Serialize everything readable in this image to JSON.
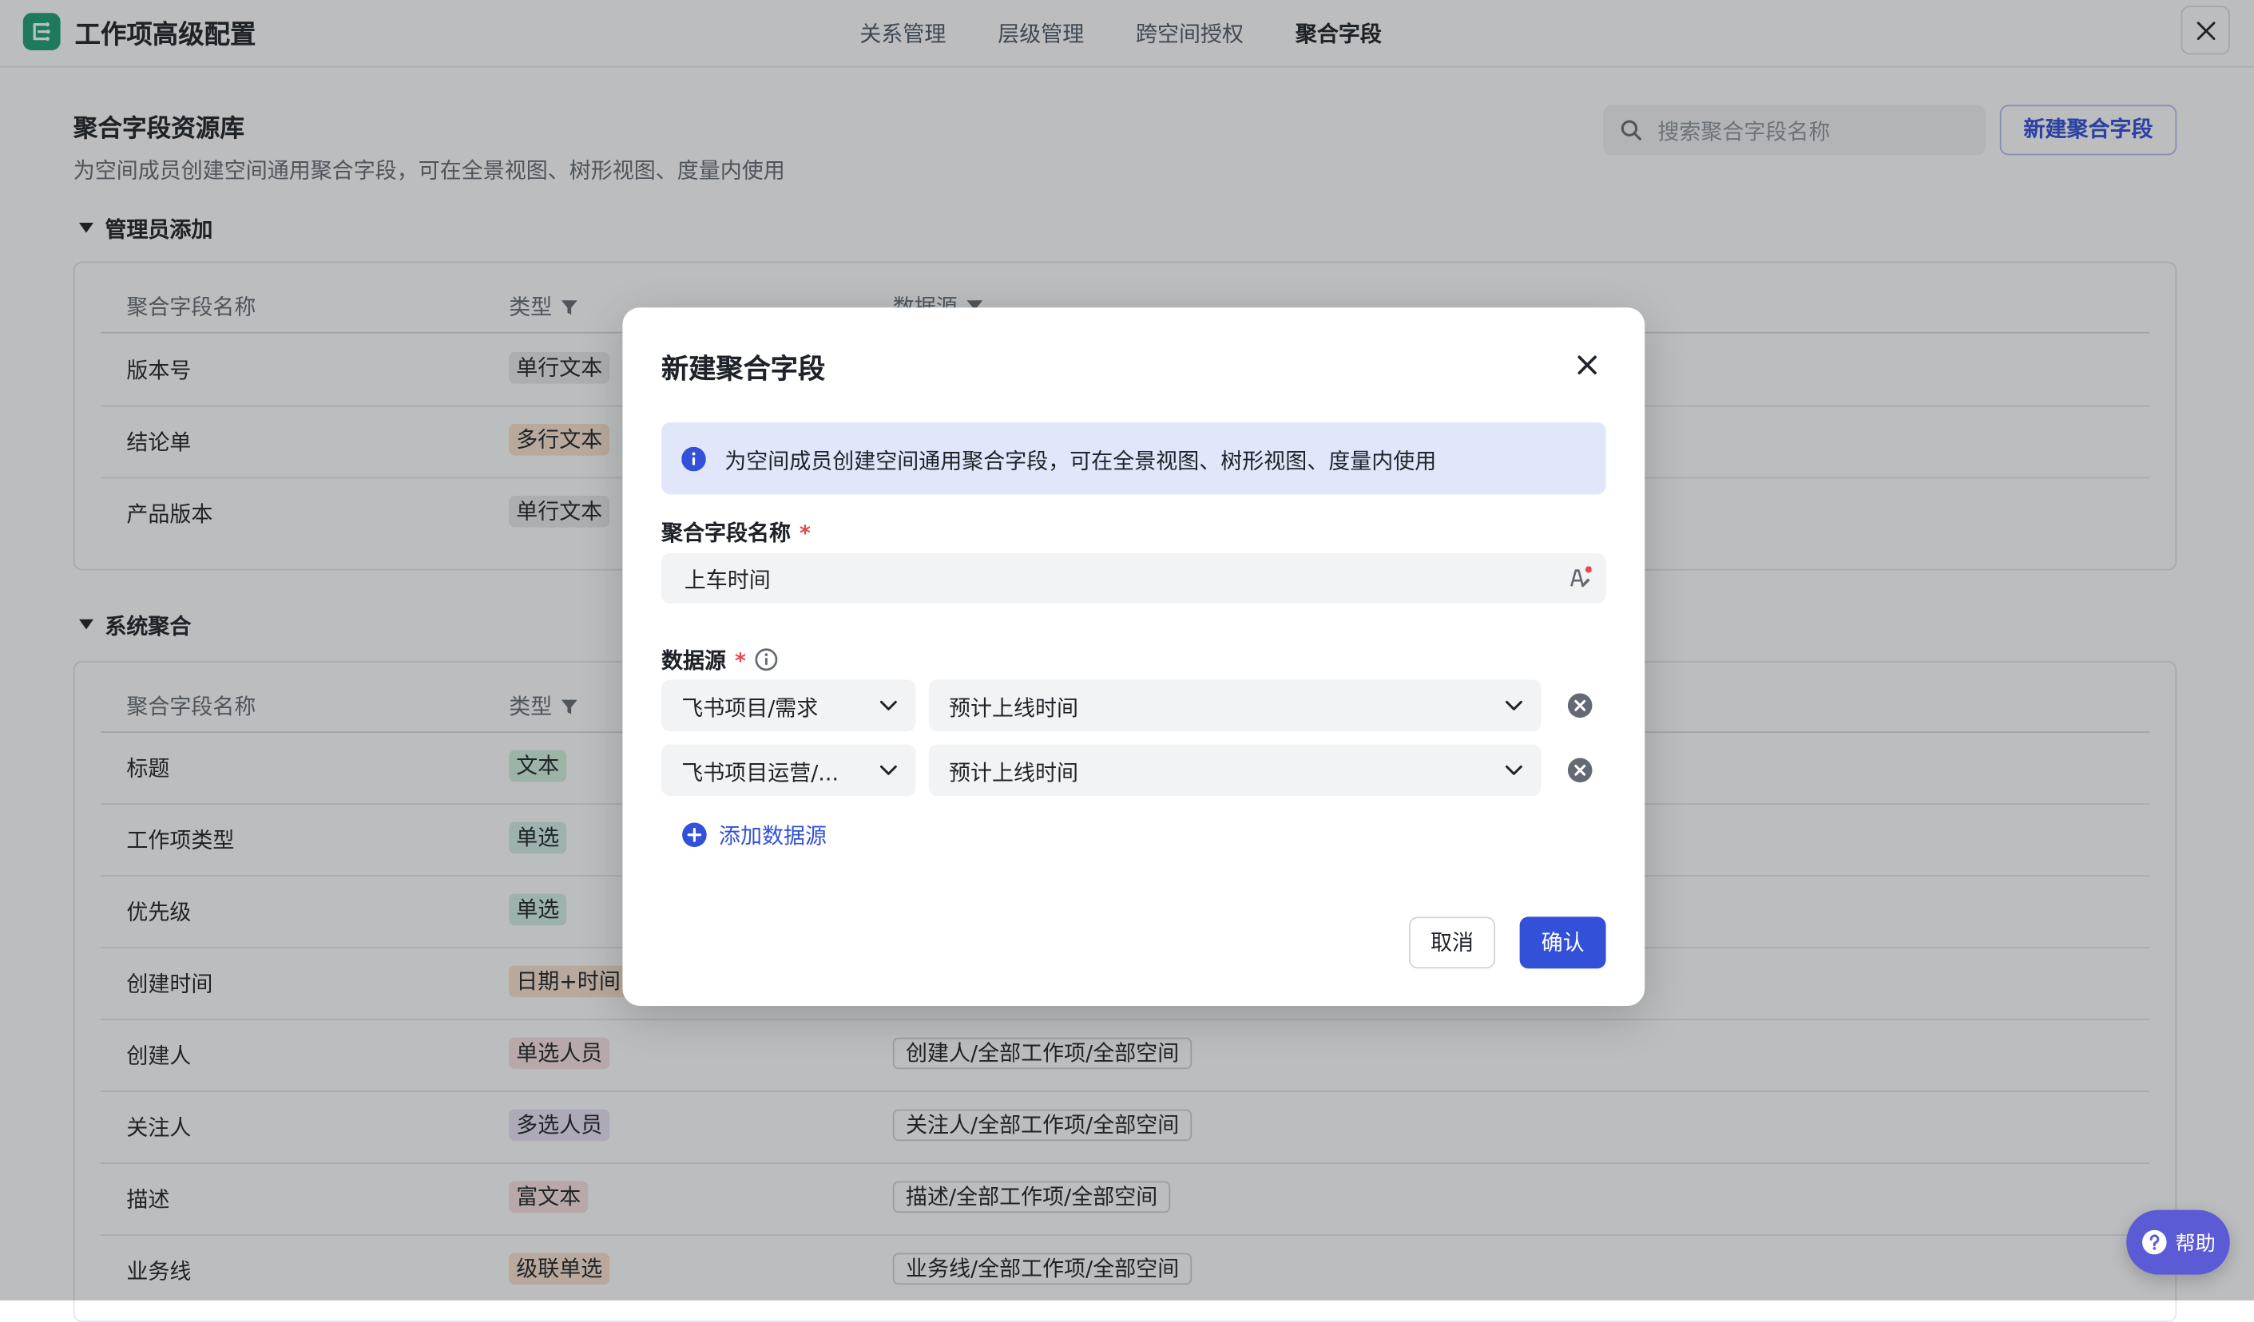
{
  "app": {
    "title": "工作项高级配置"
  },
  "tabs": [
    {
      "label": "关系管理"
    },
    {
      "label": "层级管理"
    },
    {
      "label": "跨空间授权"
    },
    {
      "label": "聚合字段"
    }
  ],
  "library": {
    "title": "聚合字段资源库",
    "description": "为空间成员创建空间通用聚合字段，可在全景视图、树形视图、度量内使用",
    "search_placeholder": "搜索聚合字段名称",
    "new_button": "新建聚合字段"
  },
  "admin_section": {
    "title": "管理员添加",
    "headers": {
      "name": "聚合字段名称",
      "type": "类型",
      "source": "数据源"
    },
    "rows": [
      {
        "name": "版本号",
        "type": "单行文本",
        "type_color": "#e9ebee",
        "type_text": "#1f2329"
      },
      {
        "name": "结论单",
        "type": "多行文本",
        "type_color": "#fbe3cf",
        "type_text": "#1f2329"
      },
      {
        "name": "产品版本",
        "type": "单行文本",
        "type_color": "#e9ebee",
        "type_text": "#1f2329"
      }
    ]
  },
  "system_section": {
    "title": "系统聚合",
    "headers": {
      "name": "聚合字段名称",
      "type": "类型"
    },
    "rows": [
      {
        "name": "标题",
        "type": "文本",
        "type_color": "#d3f2dd",
        "source": ""
      },
      {
        "name": "工作项类型",
        "type": "单选",
        "type_color": "#d4eee9",
        "source": ""
      },
      {
        "name": "优先级",
        "type": "单选",
        "type_color": "#d4eee9",
        "source": ""
      },
      {
        "name": "创建时间",
        "type": "日期+时间",
        "type_color": "#fbe3cf",
        "source": ""
      },
      {
        "name": "创建人",
        "type": "单选人员",
        "type_color": "#fbe1e1",
        "source": "创建人/全部工作项/全部空间"
      },
      {
        "name": "关注人",
        "type": "多选人员",
        "type_color": "#ebe2f7",
        "source": "关注人/全部工作项/全部空间"
      },
      {
        "name": "描述",
        "type": "富文本",
        "type_color": "#fbe1e1",
        "source": "描述/全部工作项/全部空间"
      },
      {
        "name": "业务线",
        "type": "级联单选",
        "type_color": "#fbe3cf",
        "source": "业务线/全部工作项/全部空间"
      }
    ]
  },
  "modal": {
    "title": "新建聚合字段",
    "info": "为空间成员创建空间通用聚合字段，可在全景视图、树形视图、度量内使用",
    "name_label": "聚合字段名称",
    "name_value": "上车时间",
    "required_mark": "*",
    "source_label": "数据源",
    "sources": [
      {
        "object": "飞书项目/需求",
        "field": "预计上线时间"
      },
      {
        "object": "飞书项目运营/...",
        "field": "预计上线时间"
      }
    ],
    "add_source": "添加数据源",
    "cancel": "取消",
    "confirm": "确认"
  },
  "help": {
    "label": "帮助"
  },
  "colors": {
    "accent": "#3250d8",
    "brand": "#1e9f73",
    "info_bg": "#e1e6fb",
    "required": "#e5484d"
  }
}
